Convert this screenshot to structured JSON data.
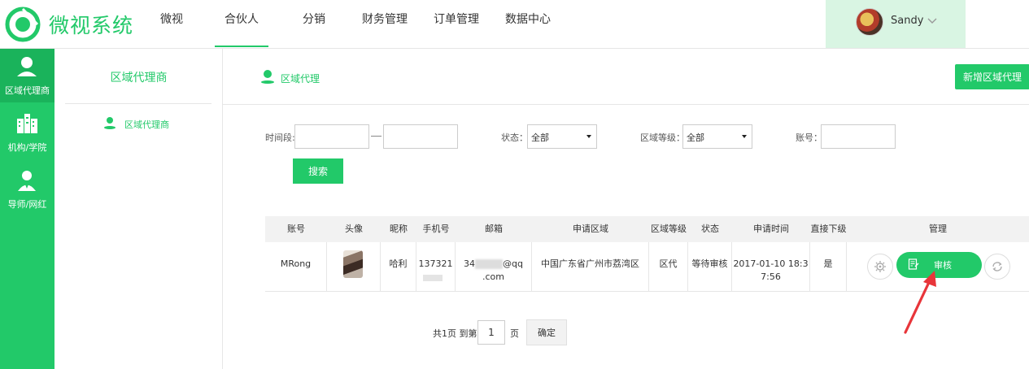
{
  "header": {
    "logo_text": "微视系统",
    "nav": [
      {
        "label": "微视"
      },
      {
        "label": "合伙人",
        "active": true
      },
      {
        "label": "分销"
      },
      {
        "label": "财务管理"
      },
      {
        "label": "订单管理"
      },
      {
        "label": "数据中心"
      }
    ],
    "user": {
      "name": "Sandy"
    }
  },
  "sidebar": {
    "items": [
      {
        "label": "区域代理商",
        "icon": "user-pin-icon",
        "active": true
      },
      {
        "label": "机构/学院",
        "icon": "building-icon"
      },
      {
        "label": "导师/网红",
        "icon": "mentor-icon"
      }
    ]
  },
  "submenu": {
    "title": "区域代理商",
    "items": [
      {
        "label": "区域代理商",
        "icon": "user-pin-icon"
      }
    ]
  },
  "page": {
    "title": "区域代理",
    "add_button": "新增区域代理"
  },
  "filters": {
    "time_label": "时间段:",
    "start_value": "",
    "end_value": "",
    "status_label": "状态：",
    "status_value": "全部",
    "level_label": "区域等级：",
    "level_value": "全部",
    "account_label": "账号：",
    "account_value": "",
    "search_button": "搜索"
  },
  "table": {
    "headers": [
      "账号",
      "头像",
      "昵称",
      "手机号",
      "邮箱",
      "申请区域",
      "区域等级",
      "状态",
      "申请时间",
      "直接下级",
      "管理"
    ],
    "rows": [
      {
        "account": "MRong",
        "nickname": "哈利",
        "phone": "137321",
        "email_start": "34",
        "email_end": "@qq",
        "email_line2": ".com",
        "region": "中国广东省广州市荔湾区",
        "level": "区代",
        "status": "等待审核",
        "apply_time_line1": "2017-01-10 18:3",
        "apply_time_line2": "7:56",
        "direct_sub": "是",
        "review_button": "审核"
      }
    ]
  },
  "pagination": {
    "total_text": "共1页 到第",
    "page_value": "1",
    "page_suffix": "页",
    "confirm_button": "确定"
  },
  "colors": {
    "accent": "#22c969",
    "accent_dark": "#1ab35b",
    "arrow": "#e8353a"
  }
}
